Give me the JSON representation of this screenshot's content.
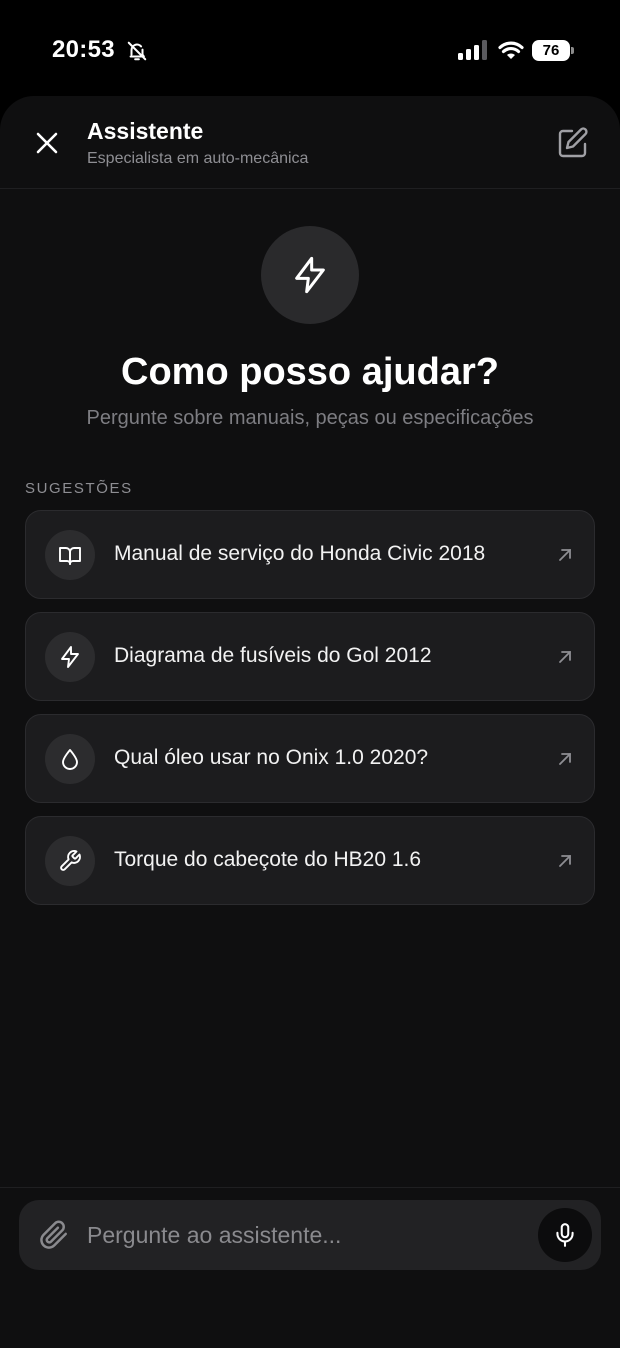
{
  "status_bar": {
    "time": "20:53",
    "battery": "76",
    "icons": [
      "bell-slash-icon",
      "signal-icon",
      "wifi-icon",
      "battery-icon"
    ]
  },
  "header": {
    "title": "Assistente",
    "subtitle": "Especialista em auto-mecânica",
    "close_icon": "close-icon",
    "new_chat_icon": "edit-icon"
  },
  "hero": {
    "icon": "lightning-icon",
    "title": "Como posso ajudar?",
    "subtitle": "Pergunte sobre manuais, peças ou especificações"
  },
  "suggestions": {
    "label": "SUGESTÕES",
    "items": [
      {
        "icon": "book-icon",
        "text": "Manual de serviço do Honda Civic 2018"
      },
      {
        "icon": "lightning-icon",
        "text": "Diagrama de fusíveis do Gol 2012"
      },
      {
        "icon": "drop-icon",
        "text": "Qual óleo usar no Onix 1.0 2020?"
      },
      {
        "icon": "wrench-icon",
        "text": "Torque do cabeçote do HB20 1.6"
      }
    ]
  },
  "composer": {
    "placeholder": "Pergunte ao assistente...",
    "value": "",
    "attach_icon": "paperclip-icon",
    "mic_icon": "microphone-icon"
  },
  "colors": {
    "background": "#000000",
    "sheet": "#0f0f10",
    "card": "#1c1c1e",
    "muted_text": "#8e8e93"
  }
}
